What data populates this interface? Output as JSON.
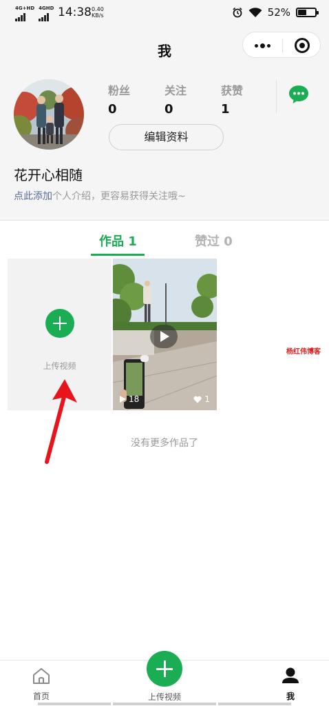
{
  "status_bar": {
    "network1": "4G+HD",
    "network2": "4GHD",
    "time": "14:38",
    "speed_value": "0.40",
    "speed_unit": "KB/s",
    "battery_percent": "52%",
    "battery_level": 0.52
  },
  "nav": {
    "title": "我"
  },
  "profile": {
    "stats": [
      {
        "label": "粉丝",
        "value": "0"
      },
      {
        "label": "关注",
        "value": "0"
      },
      {
        "label": "获赞",
        "value": "1"
      }
    ],
    "edit_label": "编辑资料",
    "nickname": "花开心相随",
    "bio_link": "点此添加",
    "bio_text": "个人介绍，更容易获得关注哦~"
  },
  "tabs": {
    "works": "作品 1",
    "liked": "赞过 0"
  },
  "grid": {
    "upload_label": "上传视频",
    "video": {
      "plays": "18",
      "likes": "1"
    }
  },
  "watermark": "杨红伟博客",
  "no_more": "没有更多作品了",
  "tabbar": {
    "home": "首页",
    "upload": "上传视频",
    "me": "我"
  },
  "colors": {
    "accent": "#1aad53",
    "link": "#576b95",
    "annotation_arrow": "#e8141c"
  },
  "icons": {
    "chat": "chat-bubble-icon",
    "home": "home-icon",
    "me": "person-icon",
    "more": "more-dots-icon",
    "close": "target-circle-icon"
  }
}
